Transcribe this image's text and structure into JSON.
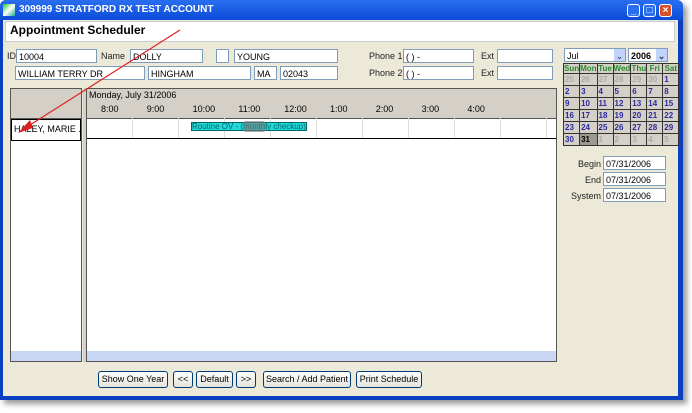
{
  "window": {
    "title": "309999 STRATFORD RX TEST ACCOUNT",
    "heading": "Appointment Scheduler"
  },
  "patient": {
    "id_label": "ID",
    "id": "10004",
    "name_label": "Name",
    "first": "DOLLY",
    "middle": "",
    "last": "YOUNG",
    "street": "WILLIAM TERRY DR",
    "city": "HINGHAM",
    "state": "MA",
    "zip": "02043",
    "phone1_label": "Phone 1",
    "phone1": "(  )   -",
    "phone2_label": "Phone 2",
    "phone2": "(  )   -",
    "ext_label": "Ext",
    "ext1": "",
    "ext2": ""
  },
  "schedule": {
    "date": "Monday, July 31/2006",
    "hours": [
      "8:00",
      "9:00",
      "10:00",
      "11:00",
      "12:00",
      "1:00",
      "2:00",
      "3:00",
      "4:00"
    ],
    "provider": "HALEY, MARIE ...",
    "appointment": "Routine OV - (monthly checkup)",
    "appointment_color": "#22d8d8"
  },
  "calendar": {
    "month": "Jul",
    "year": "2006",
    "days": [
      "Sun",
      "Mon",
      "Tue",
      "Wed",
      "Thu",
      "Fri",
      "Sat"
    ],
    "weeks": [
      [
        "25",
        "26",
        "27",
        "28",
        "29",
        "30",
        "1"
      ],
      [
        "2",
        "3",
        "4",
        "5",
        "6",
        "7",
        "8"
      ],
      [
        "9",
        "10",
        "11",
        "12",
        "13",
        "14",
        "15"
      ],
      [
        "16",
        "17",
        "18",
        "19",
        "20",
        "21",
        "22"
      ],
      [
        "23",
        "24",
        "25",
        "26",
        "27",
        "28",
        "29"
      ],
      [
        "30",
        "31",
        "1",
        "2",
        "3",
        "4",
        "5"
      ]
    ],
    "selected": "31"
  },
  "dates": {
    "begin_label": "Begin",
    "begin": "07/31/2006",
    "end_label": "End",
    "end": "07/31/2006",
    "system_label": "System",
    "system": "07/31/2006"
  },
  "buttons": {
    "show_year": "Show One Year",
    "prev": "<<",
    "default": "Default",
    "next": ">>",
    "search": "Search / Add Patient",
    "print": "Print Schedule"
  }
}
